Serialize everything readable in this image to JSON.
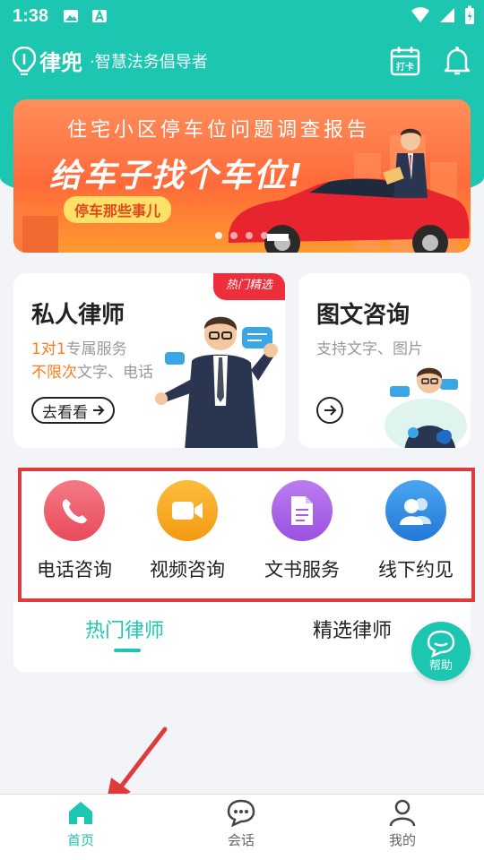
{
  "status": {
    "time": "1:38"
  },
  "header": {
    "brand": "律兜",
    "slogan": "·智慧法务倡导者",
    "checkin_label": "打卡"
  },
  "banner": {
    "line1": "住宅小区停车位问题调查报告",
    "line2": "给车子找个车位!",
    "tag": "停车那些事儿"
  },
  "private_lawyer": {
    "title": "私人律师",
    "badge": "热门精选",
    "sub1_hl": "1对1",
    "sub1_rest": "专属服务",
    "sub2_hl": "不限次",
    "sub2_rest": "文字、电话",
    "button": "去看看"
  },
  "text_consult": {
    "title": "图文咨询",
    "sub": "支持文字、图片"
  },
  "services": [
    {
      "label": "电话咨询",
      "icon": "phone-icon",
      "color": "#ef5a6a"
    },
    {
      "label": "视频咨询",
      "icon": "video-icon",
      "color": "#f7a41a"
    },
    {
      "label": "文书服务",
      "icon": "document-icon",
      "color": "#a45ee8"
    },
    {
      "label": "线下约见",
      "icon": "people-icon",
      "color": "#2f8ee6"
    }
  ],
  "tabs": [
    {
      "label": "热门律师",
      "active": true
    },
    {
      "label": "精选律师",
      "active": false
    }
  ],
  "help": {
    "label": "帮助"
  },
  "nav": [
    {
      "label": "首页",
      "icon": "home-icon",
      "active": true
    },
    {
      "label": "会话",
      "icon": "chat-icon",
      "active": false
    },
    {
      "label": "我的",
      "icon": "profile-icon",
      "active": false
    }
  ],
  "colors": {
    "primary": "#1dc6b0",
    "highlight": "#ff7a1a",
    "annotation": "#e03a3e"
  }
}
